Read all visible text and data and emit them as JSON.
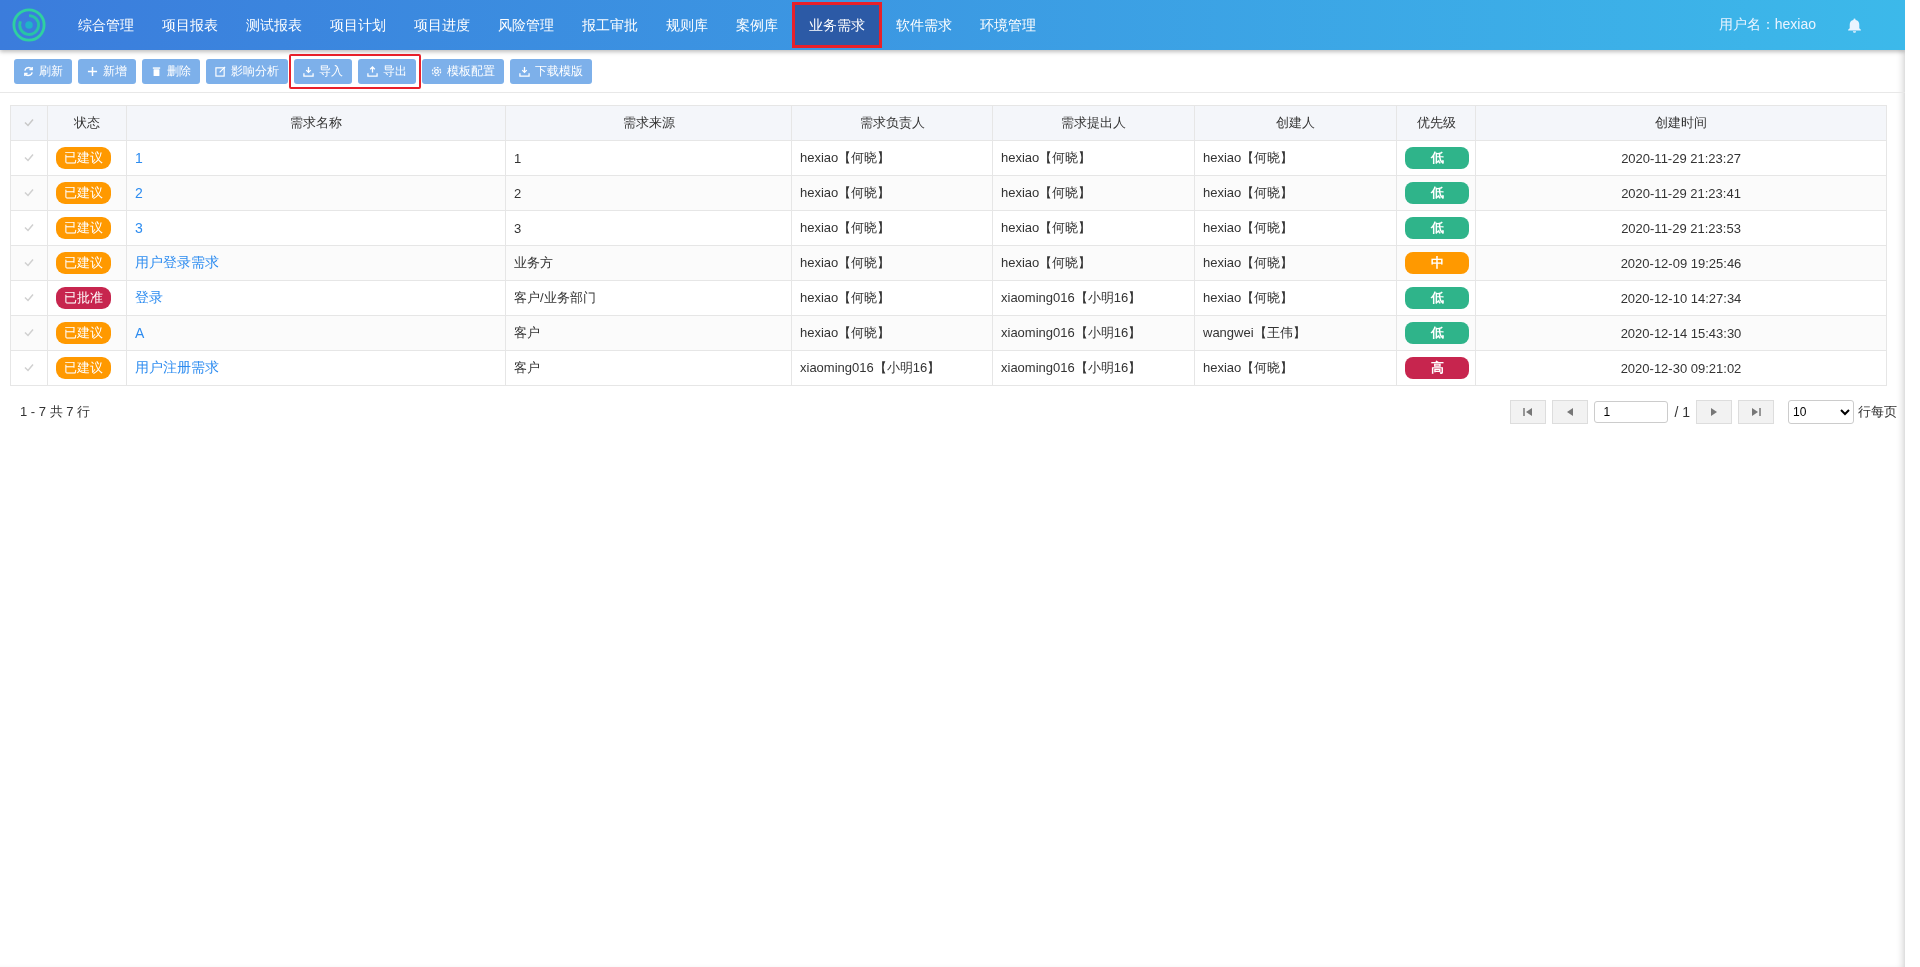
{
  "nav": {
    "items": [
      {
        "label": "综合管理",
        "selected": false,
        "highlighted": false
      },
      {
        "label": "项目报表",
        "selected": false,
        "highlighted": false
      },
      {
        "label": "测试报表",
        "selected": false,
        "highlighted": false
      },
      {
        "label": "项目计划",
        "selected": false,
        "highlighted": false
      },
      {
        "label": "项目进度",
        "selected": false,
        "highlighted": false
      },
      {
        "label": "风险管理",
        "selected": false,
        "highlighted": false
      },
      {
        "label": "报工审批",
        "selected": false,
        "highlighted": false
      },
      {
        "label": "规则库",
        "selected": false,
        "highlighted": false
      },
      {
        "label": "案例库",
        "selected": false,
        "highlighted": false
      },
      {
        "label": "业务需求",
        "selected": true,
        "highlighted": true
      },
      {
        "label": "软件需求",
        "selected": false,
        "highlighted": false
      },
      {
        "label": "环境管理",
        "selected": false,
        "highlighted": false
      }
    ],
    "user": "用户名：hexiao"
  },
  "toolbar": [
    {
      "highlighted": false,
      "buttons": [
        "刷新",
        "新增",
        "删除",
        "影响分析"
      ]
    },
    {
      "highlighted": true,
      "buttons": [
        "导入",
        "导出"
      ]
    },
    {
      "highlighted": false,
      "buttons": [
        "模板配置",
        "下载模版"
      ]
    }
  ],
  "table": {
    "columns": [
      "状态",
      "需求名称",
      "需求来源",
      "需求负责人",
      "需求提出人",
      "创建人",
      "优先级",
      "创建时间"
    ],
    "rows": [
      {
        "status": {
          "text": "已建议",
          "color": "#ff9900"
        },
        "name": "1",
        "source": "1",
        "owner": "hexiao【何晓】",
        "proposer": "hexiao【何晓】",
        "creator": "hexiao【何晓】",
        "priority": {
          "text": "低",
          "color": "#2fb48a"
        },
        "created": "2020-11-29 21:23:27"
      },
      {
        "status": {
          "text": "已建议",
          "color": "#ff9900"
        },
        "name": "2",
        "source": "2",
        "owner": "hexiao【何晓】",
        "proposer": "hexiao【何晓】",
        "creator": "hexiao【何晓】",
        "priority": {
          "text": "低",
          "color": "#2fb48a"
        },
        "created": "2020-11-29 21:23:41"
      },
      {
        "status": {
          "text": "已建议",
          "color": "#ff9900"
        },
        "name": "3",
        "source": "3",
        "owner": "hexiao【何晓】",
        "proposer": "hexiao【何晓】",
        "creator": "hexiao【何晓】",
        "priority": {
          "text": "低",
          "color": "#2fb48a"
        },
        "created": "2020-11-29 21:23:53"
      },
      {
        "status": {
          "text": "已建议",
          "color": "#ff9900"
        },
        "name": "用户登录需求",
        "source": "业务方",
        "owner": "hexiao【何晓】",
        "proposer": "hexiao【何晓】",
        "creator": "hexiao【何晓】",
        "priority": {
          "text": "中",
          "color": "#ff9900"
        },
        "created": "2020-12-09 19:25:46"
      },
      {
        "status": {
          "text": "已批准",
          "color": "#c7254e"
        },
        "name": "登录",
        "source": "客户/业务部门",
        "owner": "hexiao【何晓】",
        "proposer": "xiaoming016【小明16】",
        "creator": "hexiao【何晓】",
        "priority": {
          "text": "低",
          "color": "#2fb48a"
        },
        "created": "2020-12-10 14:27:34"
      },
      {
        "status": {
          "text": "已建议",
          "color": "#ff9900"
        },
        "name": "A",
        "source": "客户",
        "owner": "hexiao【何晓】",
        "proposer": "xiaoming016【小明16】",
        "creator": "wangwei【王伟】",
        "priority": {
          "text": "低",
          "color": "#2fb48a"
        },
        "created": "2020-12-14 15:43:30"
      },
      {
        "status": {
          "text": "已建议",
          "color": "#ff9900"
        },
        "name": "用户注册需求",
        "source": "客户",
        "owner": "xiaoming016【小明16】",
        "proposer": "xiaoming016【小明16】",
        "creator": "hexiao【何晓】",
        "priority": {
          "text": "高",
          "color": "#c7254e"
        },
        "created": "2020-12-30 09:21:02"
      }
    ]
  },
  "pager": {
    "summary": "1 - 7 共 7 行",
    "page": "1",
    "of": "/ 1",
    "page_size": "10",
    "per_page_label": "行每页"
  }
}
